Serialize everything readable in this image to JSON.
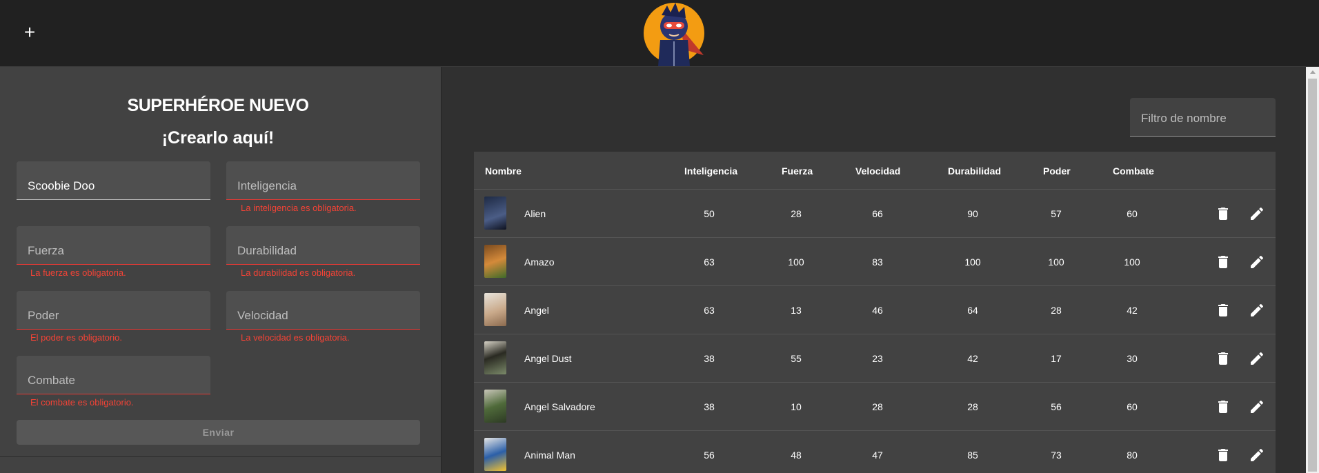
{
  "header": {
    "add_icon_glyph": "+"
  },
  "form": {
    "title": "SUPERHÉROE NUEVO",
    "subtitle": "¡Crearlo aquí!",
    "fields": {
      "name": {
        "value": "Scoobie Doo",
        "placeholder": "Nombre"
      },
      "intelligence": {
        "value": "",
        "placeholder": "Inteligencia",
        "error": "La inteligencia es obligatoria."
      },
      "strength": {
        "value": "",
        "placeholder": "Fuerza",
        "error": "La fuerza es obligatoria."
      },
      "durability": {
        "value": "",
        "placeholder": "Durabilidad",
        "error": "La durabilidad es obligatoria."
      },
      "power": {
        "value": "",
        "placeholder": "Poder",
        "error": "El poder es obligatorio."
      },
      "speed": {
        "value": "",
        "placeholder": "Velocidad",
        "error": "La velocidad es obligatoria."
      },
      "combat": {
        "value": "",
        "placeholder": "Combate",
        "error": "El combate es obligatorio."
      }
    },
    "submit_label": "Enviar"
  },
  "filter": {
    "placeholder": "Filtro de nombre"
  },
  "table": {
    "headers": {
      "name": "Nombre",
      "intelligence": "Inteligencia",
      "strength": "Fuerza",
      "speed": "Velocidad",
      "durability": "Durabilidad",
      "power": "Poder",
      "combat": "Combate"
    },
    "rows": [
      {
        "name": "Alien",
        "intelligence": "50",
        "strength": "28",
        "speed": "66",
        "durability": "90",
        "power": "57",
        "combat": "60"
      },
      {
        "name": "Amazo",
        "intelligence": "63",
        "strength": "100",
        "speed": "83",
        "durability": "100",
        "power": "100",
        "combat": "100"
      },
      {
        "name": "Angel",
        "intelligence": "63",
        "strength": "13",
        "speed": "46",
        "durability": "64",
        "power": "28",
        "combat": "42"
      },
      {
        "name": "Angel Dust",
        "intelligence": "38",
        "strength": "55",
        "speed": "23",
        "durability": "42",
        "power": "17",
        "combat": "30"
      },
      {
        "name": "Angel Salvadore",
        "intelligence": "38",
        "strength": "10",
        "speed": "28",
        "durability": "28",
        "power": "56",
        "combat": "60"
      },
      {
        "name": "Animal Man",
        "intelligence": "56",
        "strength": "48",
        "speed": "47",
        "durability": "85",
        "power": "73",
        "combat": "80"
      }
    ]
  },
  "colors": {
    "error": "#f44336",
    "topbar": "#212121",
    "panel": "#424242",
    "background": "#303030"
  }
}
